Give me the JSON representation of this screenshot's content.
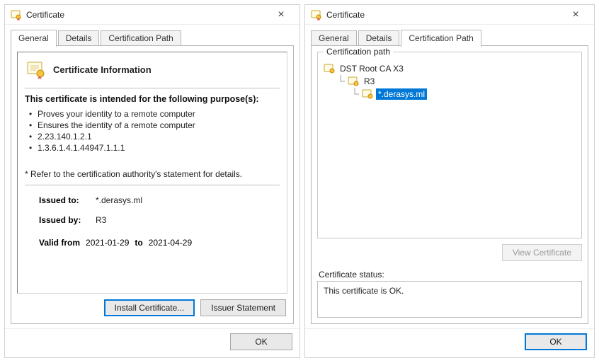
{
  "left": {
    "title": "Certificate",
    "tabs": {
      "general": "General",
      "details": "Details",
      "certpath": "Certification Path"
    },
    "info_heading": "Certificate Information",
    "purpose_title": "This certificate is intended for the following purpose(s):",
    "purposes": [
      "Proves your identity to a remote computer",
      "Ensures the identity of a remote computer",
      "2.23.140.1.2.1",
      "1.3.6.1.4.1.44947.1.1.1"
    ],
    "refer_note": "* Refer to the certification authority's statement for details.",
    "issued_to_label": "Issued to:",
    "issued_to": "*.derasys.ml",
    "issued_by_label": "Issued by:",
    "issued_by": "R3",
    "valid_from_label": "Valid from",
    "valid_from": "2021-01-29",
    "valid_to_label": "to",
    "valid_to": "2021-04-29",
    "install_btn": "Install Certificate...",
    "issuer_btn": "Issuer Statement",
    "ok_btn": "OK"
  },
  "right": {
    "title": "Certificate",
    "tabs": {
      "general": "General",
      "details": "Details",
      "certpath": "Certification Path"
    },
    "group_label": "Certification path",
    "chain": [
      {
        "name": "DST Root CA X3"
      },
      {
        "name": "R3"
      },
      {
        "name": "*.derasys.ml"
      }
    ],
    "view_cert_btn": "View Certificate",
    "status_label": "Certificate status:",
    "status_text": "This certificate is OK.",
    "ok_btn": "OK"
  }
}
